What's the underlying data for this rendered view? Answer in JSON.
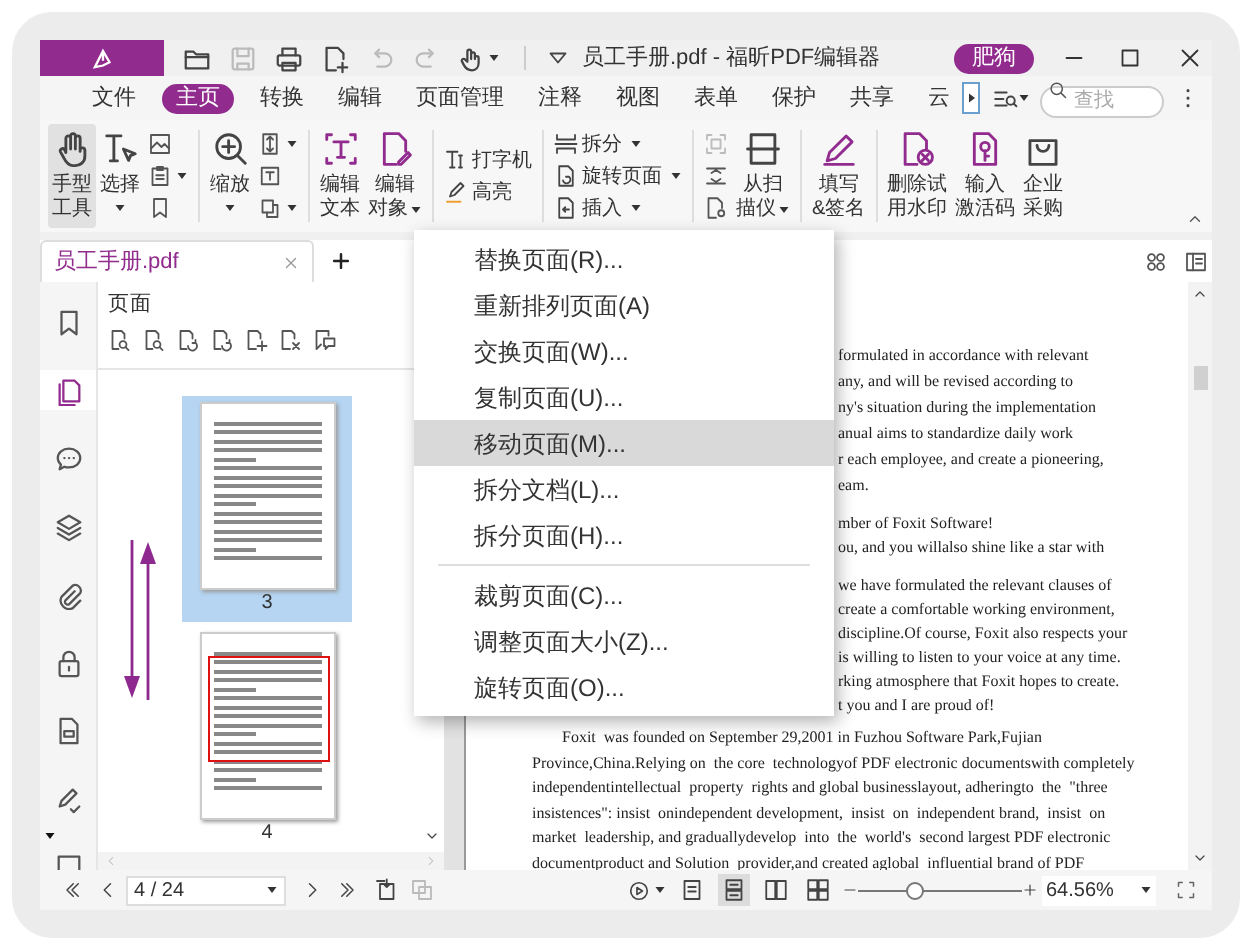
{
  "title_bar": {
    "tools": [
      {
        "kind": "open",
        "disabled": false
      },
      {
        "kind": "save",
        "disabled": true
      },
      {
        "kind": "print",
        "disabled": false
      },
      {
        "kind": "new",
        "disabled": false
      },
      {
        "kind": "undo",
        "disabled": true
      },
      {
        "kind": "redo",
        "disabled": true
      },
      {
        "kind": "touch",
        "disabled": false
      }
    ],
    "title": "员工手册.pdf - 福昕PDF编辑器",
    "user": "肥狗"
  },
  "menu_tabs": [
    {
      "label": "文件",
      "selected": false
    },
    {
      "label": "主页",
      "selected": true
    },
    {
      "label": "转换",
      "selected": false
    },
    {
      "label": "编辑",
      "selected": false
    },
    {
      "label": "页面管理",
      "selected": false
    },
    {
      "label": "注释",
      "selected": false
    },
    {
      "label": "视图",
      "selected": false
    },
    {
      "label": "表单",
      "selected": false
    },
    {
      "label": "保护",
      "selected": false
    },
    {
      "label": "共享",
      "selected": false
    },
    {
      "label": "云",
      "selected": false
    }
  ],
  "search": {
    "placeholder": "查找"
  },
  "ribbon": [
    {
      "kind": "large",
      "lines": [
        "手型",
        "工具"
      ],
      "menu": false,
      "selected": true
    },
    {
      "kind": "large",
      "lines": [
        "选择"
      ],
      "menu": true,
      "selected": false
    },
    {
      "kind": "icons",
      "items": [
        {
          "menu": false,
          "disabled": false
        },
        {
          "menu": true,
          "disabled": false
        },
        {
          "menu": false,
          "disabled": false
        }
      ]
    },
    {
      "kind": "separator"
    },
    {
      "kind": "large",
      "lines": [
        "缩放"
      ],
      "menu": true,
      "selected": false
    },
    {
      "kind": "icons",
      "items": [
        {
          "menu": true,
          "disabled": false
        },
        {
          "menu": false,
          "disabled": false
        },
        {
          "menu": true,
          "disabled": false
        }
      ]
    },
    {
      "kind": "separator"
    },
    {
      "kind": "large",
      "lines": [
        "编辑",
        "文本"
      ],
      "menu": false,
      "selected": false
    },
    {
      "kind": "large",
      "lines": [
        "编辑",
        "对象"
      ],
      "menu": true,
      "selected": false
    },
    {
      "kind": "separator"
    },
    {
      "kind": "small",
      "items": [
        {
          "label": "打字机",
          "menu": false
        },
        {
          "label": "高亮",
          "menu": false
        }
      ]
    },
    {
      "kind": "separator"
    },
    {
      "kind": "small",
      "items": [
        {
          "label": "拆分",
          "menu": true
        },
        {
          "label": "旋转页面",
          "menu": true
        },
        {
          "label": "插入",
          "menu": true
        }
      ]
    },
    {
      "kind": "separator"
    },
    {
      "kind": "icons",
      "items": [
        {
          "menu": false,
          "disabled": true
        },
        {
          "menu": false,
          "disabled": false
        },
        {
          "menu": false,
          "disabled": false
        }
      ]
    },
    {
      "kind": "large",
      "lines": [
        "从扫",
        "描仪"
      ],
      "menu": true,
      "selected": false
    },
    {
      "kind": "separator"
    },
    {
      "kind": "large",
      "lines": [
        "填写",
        "&签名"
      ],
      "menu": false,
      "selected": false
    },
    {
      "kind": "separator"
    },
    {
      "kind": "large",
      "lines": [
        "删除试",
        "用水印"
      ],
      "menu": false,
      "selected": false
    },
    {
      "kind": "large",
      "lines": [
        "输入",
        "激活码"
      ],
      "menu": false,
      "selected": false
    },
    {
      "kind": "large",
      "lines": [
        "企业",
        "采购"
      ],
      "menu": false,
      "selected": false
    }
  ],
  "doc_tabs": [
    {
      "label": "员工手册.pdf",
      "selected": true
    }
  ],
  "sidebar": [
    {
      "selected": false
    },
    {
      "selected": true
    },
    {
      "selected": false
    },
    {
      "selected": false
    },
    {
      "selected": false
    },
    {
      "selected": false
    },
    {
      "selected": false
    },
    {
      "selected": false
    },
    {
      "selected": false
    }
  ],
  "pages_panel": {
    "title": "页面",
    "thumbnails": [
      {
        "label": "3",
        "selected": true,
        "framed": false
      },
      {
        "label": "4",
        "selected": false,
        "framed": true
      }
    ]
  },
  "context_menu": {
    "groups": [
      [
        {
          "label": "替换页面(R)...",
          "selected": false
        },
        {
          "label": "重新排列页面(A)",
          "selected": false
        },
        {
          "label": "交换页面(W)...",
          "selected": false
        },
        {
          "label": "复制页面(U)...",
          "selected": false
        },
        {
          "label": "移动页面(M)...",
          "selected": true
        },
        {
          "label": "拆分文档(L)...",
          "selected": false
        },
        {
          "label": "拆分页面(H)...",
          "selected": false
        }
      ],
      [
        {
          "label": "裁剪页面(C)...",
          "selected": false
        },
        {
          "label": "调整页面大小(Z)...",
          "selected": false
        },
        {
          "label": "旋转页面(O)...",
          "selected": false
        }
      ]
    ]
  },
  "document": {
    "fragment_blocks": [
      [
        "formulated in accordance with relevant",
        "any, and will be revised according to",
        "ny's situation during the implementation",
        "anual aims to standardize daily work",
        "r each employee, and create a pioneering,",
        "eam."
      ],
      [
        "mber of Foxit Software!",
        "ou, and you willalso shine like a star with"
      ],
      [
        "we have formulated the relevant clauses of",
        "create a comfortable working environment,",
        "discipline.Of course, Foxit also respects your",
        "is willing to listen to your voice at any time.",
        "rking atmosphere that Foxit hopes to create.",
        "t you and I are proud of!"
      ]
    ],
    "paragraph": [
      "Foxit  was founded on September 29,2001 in Fuzhou Software Park,Fujian",
      "Province,China.Relying on  the core  technologyof PDF electronic documentswith completely",
      "independentintellectual  property  rights and global businesslayout, adheringto  the  \"three",
      "insistences\": insist  onindependent development,  insist  on  independent brand,  insist  on",
      "market  leadership, and graduallydevelop  into  the  world's  second largest PDF electronic",
      "documentproduct and Solution  provider,and created aglobal  influential brand of PDF"
    ]
  },
  "status_bar": {
    "page": "4 / 24",
    "view_modes": [
      {
        "selected": false
      },
      {
        "selected": true
      },
      {
        "selected": false
      },
      {
        "selected": false
      }
    ],
    "zoom": {
      "level": 0.35,
      "value": "64.56%"
    }
  }
}
